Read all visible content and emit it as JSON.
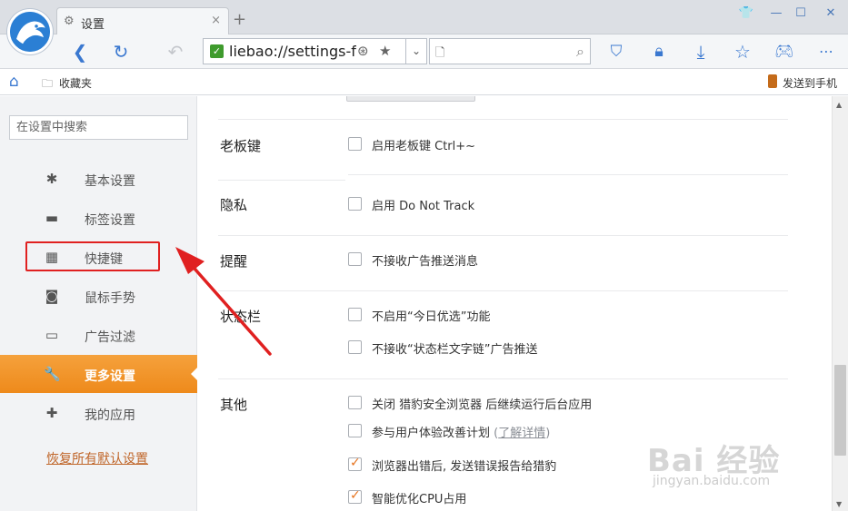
{
  "window": {
    "tab_title": "设置",
    "tab_close": "×",
    "new_tab": "+",
    "controls": {
      "shirt": "👕",
      "minimize": "—",
      "maximize": "☐",
      "close": "✕"
    }
  },
  "toolbar": {
    "url": "liebao://settings-frame/",
    "secure_mark": "✓",
    "dropdown": "⌄",
    "search_value": ""
  },
  "bookmarks": {
    "folder_label": "收藏夹",
    "send_to_phone": "发送到手机"
  },
  "sidebar": {
    "search_placeholder": "在设置中搜索",
    "items": [
      {
        "label": "基本设置",
        "icon": "gear-icon",
        "glyph": "✱"
      },
      {
        "label": "标签设置",
        "icon": "tab-icon",
        "glyph": "▬"
      },
      {
        "label": "快捷键",
        "icon": "shortcut-icon",
        "glyph": "▦"
      },
      {
        "label": "鼠标手势",
        "icon": "mouse-icon",
        "glyph": "◙"
      },
      {
        "label": "广告过滤",
        "icon": "window-icon",
        "glyph": "▭"
      },
      {
        "label": "更多设置",
        "icon": "wrench-icon",
        "glyph": "🔧",
        "active": true
      },
      {
        "label": "我的应用",
        "icon": "puzzle-icon",
        "glyph": "✚"
      }
    ],
    "restore_label": "恢复所有默认设置"
  },
  "content": {
    "sections": [
      {
        "title": "老板键",
        "options": [
          {
            "label": "启用老板键  Ctrl+~",
            "checked": false
          }
        ]
      },
      {
        "title": "隐私",
        "options": [
          {
            "label": "启用 Do Not Track",
            "checked": false
          }
        ]
      },
      {
        "title": "提醒",
        "options": [
          {
            "label": "不接收广告推送消息",
            "checked": false
          }
        ]
      },
      {
        "title": "状态栏",
        "options": [
          {
            "label": "不启用“今日优选”功能",
            "checked": false
          },
          {
            "label": "不接收“状态栏文字链”广告推送",
            "checked": false
          }
        ]
      },
      {
        "title": "其他",
        "options": [
          {
            "label": "关闭 猎豹安全浏览器 后继续运行后台应用",
            "checked": false
          },
          {
            "label": "参与用户体验改善计划",
            "checked": false,
            "link": "了解详情",
            "paren_open": "(",
            "paren_close": ")"
          },
          {
            "label": "浏览器出错后, 发送错误报告给猎豹",
            "checked": true
          },
          {
            "label": "智能优化CPU占用",
            "checked": true
          }
        ]
      }
    ]
  },
  "watermark": {
    "main": "Bai 经验",
    "sub": "jingyan.baidu.com"
  },
  "colors": {
    "accent": "#f0901f",
    "link": "#c0662a",
    "brand_blue": "#2b7fd4",
    "annotation": "#e02020"
  }
}
